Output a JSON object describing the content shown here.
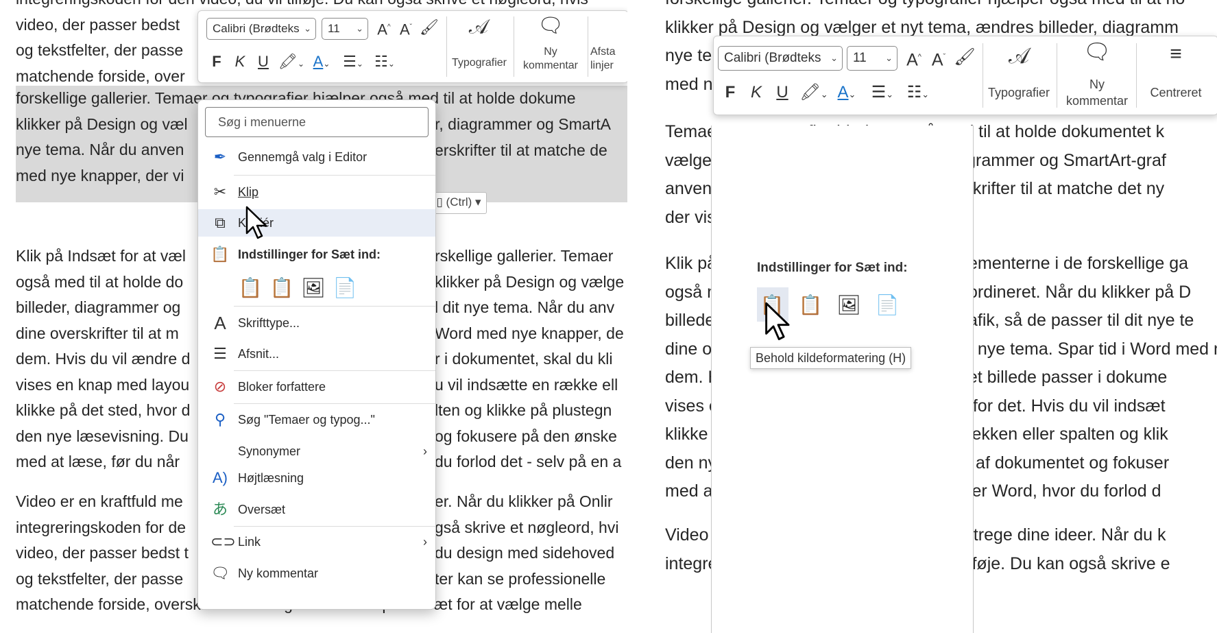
{
  "left": {
    "paragraphs": [
      [
        "integreringskoden for den video, du vil tilføje. Du kan også skrive et nøgleord, hvis",
        "video, der passer bedst",
        "og tekstfelter, der passe",
        "matchende forside, over"
      ],
      [
        "forskellige gallerier. Temaer og typografier hjælper også med til at holde dokume",
        "klikker på Design og væl",
        "nye tema. Når du anven",
        "med nye knapper, der vi"
      ],
      [
        "Klik på Indsæt for at væl",
        "også med til at holde do",
        "billeder, diagrammer og",
        "dine overskrifter til at m",
        "dem. Hvis du vil ændre d",
        "vises en knap med layou",
        "klikke på det sted, hvor d",
        "den nye læsevisning. Du",
        "med at læse, før du når"
      ],
      [
        "Video er en kraftfuld me",
        "integreringskoden for de",
        "video, der passer bedst t",
        "og tekstfelter, der passe",
        "matchende forside, overskrift eller margentekst. Klik på Indsæt for at vælge melle"
      ]
    ],
    "right_fragments": [
      "r, diagrammer og SmartA",
      "erskrifter til at matche de",
      "rskellige gallerier. Temaer",
      "klikker på Design og vælge",
      "l dit nye tema. Når du anv",
      "Word med nye knapper, de",
      "r i dokumentet, skal du kli",
      "u vil indsætte en række ell",
      "lten og klikke på plustegn",
      "og fokusere på den ønske",
      "du forlod det - selv på en a",
      "er. Når du klikker på Onlir",
      "gså skrive et nøgleord, hvi",
      "du design med sidehoved",
      "ter kan se professionelle",
      "Klik på Indsæt for at vælge melle"
    ],
    "ctrl_tag": "(Ctrl)"
  },
  "toolbar_left": {
    "font": "Calibri (Brødteks",
    "size": "11",
    "styles_label": "Typografier",
    "new_comment_label_1": "Ny",
    "new_comment_label_2": "kommentar",
    "spacing_label_1": "Afsta",
    "spacing_label_2": "linjer",
    "bold": "F",
    "italic": "K",
    "underline": "U"
  },
  "context_menu": {
    "search_placeholder": "Søg i menuerne",
    "items": {
      "editor": "Gennemgå valg i Editor",
      "cut": "Klip",
      "copy": "Kopiér",
      "paste_options": "Indstillinger for Sæt ind:",
      "font": "Skrifttype...",
      "paragraph": "Afsnit...",
      "block_authors": "Bloker forfattere",
      "search": "Søg \"Temaer og typog...\"",
      "synonyms": "Synonymer",
      "read_aloud": "Højtlæsning",
      "translate": "Oversæt",
      "link": "Link",
      "new_comment": "Ny kommentar"
    }
  },
  "right": {
    "paragraphs": [
      [
        "forskellige gallerier. Temaer og typografier hjælper også med til at ho",
        "klikker på Design og vælger et nyt tema, ændres billeder, diagramm",
        "nye te",
        "med n"
      ],
      [
        "Temaer og typografier hjælper også med til at holde dokumentet k",
        "vælger et nyt tema, ændres billeder, diagrammer og SmartArt-graf",
        "anvender typografier, ændres dine overskrifter til at matche det ny",
        "der vises, når du har brug for dem."
      ],
      [
        "Klik på Ind",
        "også med",
        "billeder, di",
        "dine overs",
        "dem. Hvis du vil ændre den måde, som et billede passer i dokume",
        "vises en knap med layoutindstillinger ud for det. Hvis du vil indsæt",
        "klikke på det sted, hvor du vil indsætte rækken eller spalten og klik",
        "den nye læsevisning. Du kan skjule dele af dokumentet og fokuser",
        "med at læse, før du når slutningen, husker Word, hvor du forlod d"
      ],
      [
        "Video er en kraftfuld metode til at understrege dine ideer. Når du k",
        "integreringskoden for den video, du vil tilføje. Du kan også skrive e"
      ]
    ],
    "fragments": [
      "ementerne i de forskellige ga",
      "ordineret. Når du klikker på D",
      "afik, så de passer til dit nye te",
      "t nye tema. Spar tid i Word med n"
    ],
    "paste_popup_title": "Indstillinger for Sæt ind:",
    "tooltip": "Behold kildeformatering (H)"
  },
  "toolbar_right": {
    "font": "Calibri (Brødteks",
    "size": "11",
    "styles_label": "Typografier",
    "new_comment_label_1": "Ny",
    "new_comment_label_2": "kommentar",
    "center_label": "Centreret",
    "bold": "F",
    "italic": "K",
    "underline": "U"
  }
}
